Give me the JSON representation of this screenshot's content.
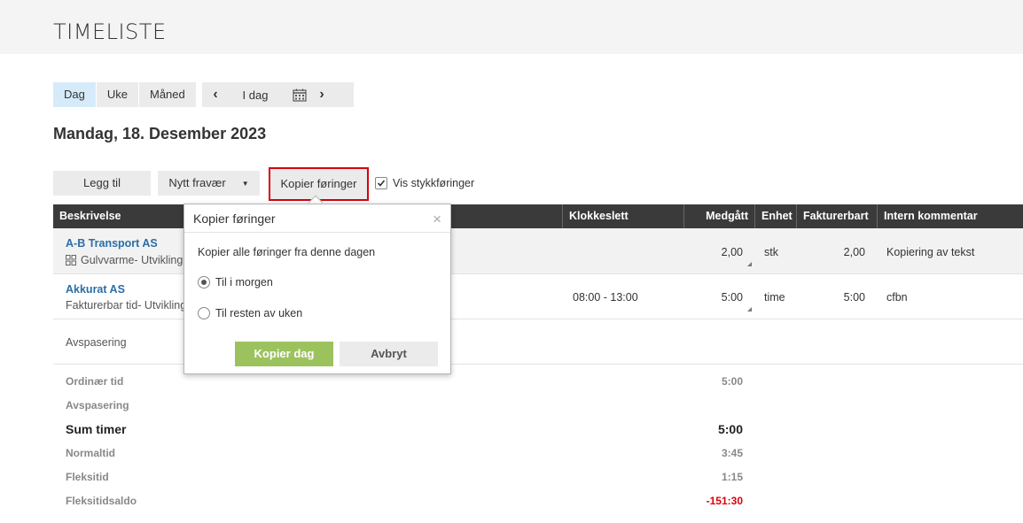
{
  "header": {
    "title": "TIMELISTE"
  },
  "view_switch": {
    "day": "Dag",
    "week": "Uke",
    "month": "Måned",
    "active": "Dag"
  },
  "date_nav": {
    "prev": "‹",
    "today": "I dag",
    "next": "›"
  },
  "day_title": "Mandag, 18. Desember 2023",
  "toolbar": {
    "add_label": "Legg til",
    "absence_label": "Nytt fravær",
    "copy_label": "Kopier føringer",
    "show_pieces_label": "Vis stykkføringer",
    "show_pieces_checked": true
  },
  "table": {
    "columns": [
      "Beskrivelse",
      "Klokkeslett",
      "Medgått",
      "Enhet",
      "Fakturerbart",
      "Intern kommentar"
    ],
    "rows": [
      {
        "company": "A-B Transport AS",
        "task": "Gulvvarme- Utvikling",
        "time_range": "",
        "spent": "2,00",
        "unit": "stk",
        "billable": "2,00",
        "comment": "Kopiering av tekst"
      },
      {
        "company": "Akkurat AS",
        "task": "Fakturerbar tid- Utvikling",
        "time_range": "08:00 - 13:00",
        "spent": "5:00",
        "unit": "time",
        "billable": "5:00",
        "comment": "cfbn"
      },
      {
        "label": "Avspasering"
      }
    ]
  },
  "summary": {
    "ordinary": {
      "label": "Ordinær tid",
      "value": "5:00"
    },
    "leave": {
      "label": "Avspasering",
      "value": ""
    },
    "total": {
      "label": "Sum timer",
      "value": "5:00"
    },
    "normal": {
      "label": "Normaltid",
      "value": "3:45"
    },
    "flex": {
      "label": "Fleksitid",
      "value": "1:15"
    },
    "flex_balance": {
      "label": "Fleksitidsaldo",
      "value": "-151:30"
    }
  },
  "popover": {
    "title": "Kopier føringer",
    "close": "×",
    "description": "Kopier alle føringer fra denne dagen",
    "options": [
      {
        "label": "Til i morgen",
        "selected": true
      },
      {
        "label": "Til resten av uken",
        "selected": false
      }
    ],
    "confirm_label": "Kopier dag",
    "cancel_label": "Avbryt"
  },
  "colors": {
    "accent_blue": "#2b6ea6",
    "confirm_green": "#9cc25e",
    "highlight_red": "#d9000d",
    "header_dark": "#3a3a3a"
  }
}
